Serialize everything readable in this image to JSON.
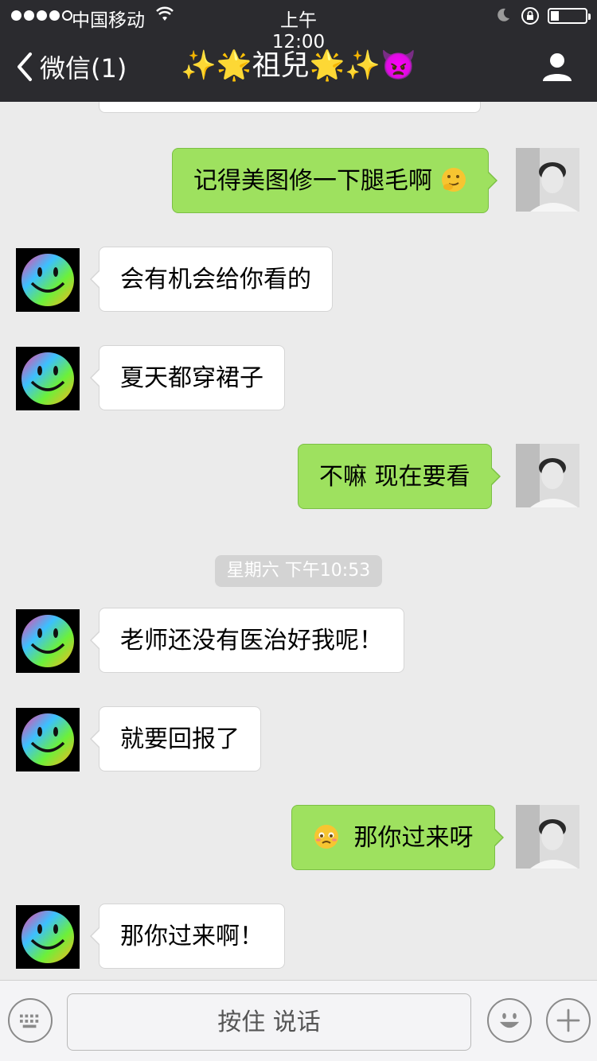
{
  "status_bar": {
    "carrier": "中国移动",
    "time": "上午12:00"
  },
  "nav": {
    "back_label": "微信(1)",
    "title": "✨🌟祖兒🌟✨👿"
  },
  "messages": [
    {
      "side": "out",
      "text": "记得美图修一下腿毛啊",
      "emoji_after": "thinking-emoji"
    },
    {
      "side": "in",
      "text": "会有机会给你看的"
    },
    {
      "side": "in",
      "text": "夏天都穿裙子"
    },
    {
      "side": "out",
      "text": "不嘛 现在要看"
    },
    {
      "side": "in",
      "text": "老师还没有医治好我呢！"
    },
    {
      "side": "in",
      "text": "就要回报了"
    },
    {
      "side": "out",
      "text": "那你过来呀",
      "emoji_before": "pleading-emoji"
    },
    {
      "side": "in",
      "text": "那你过来啊！"
    }
  ],
  "timestamp": "星期六 下午10:53",
  "input_bar": {
    "talk_label": "按住 说话"
  },
  "colors": {
    "nav_bg": "#2b2b2f",
    "chat_bg": "#ebebeb",
    "out_bubble": "#9ee15f",
    "in_bubble": "#ffffff"
  }
}
